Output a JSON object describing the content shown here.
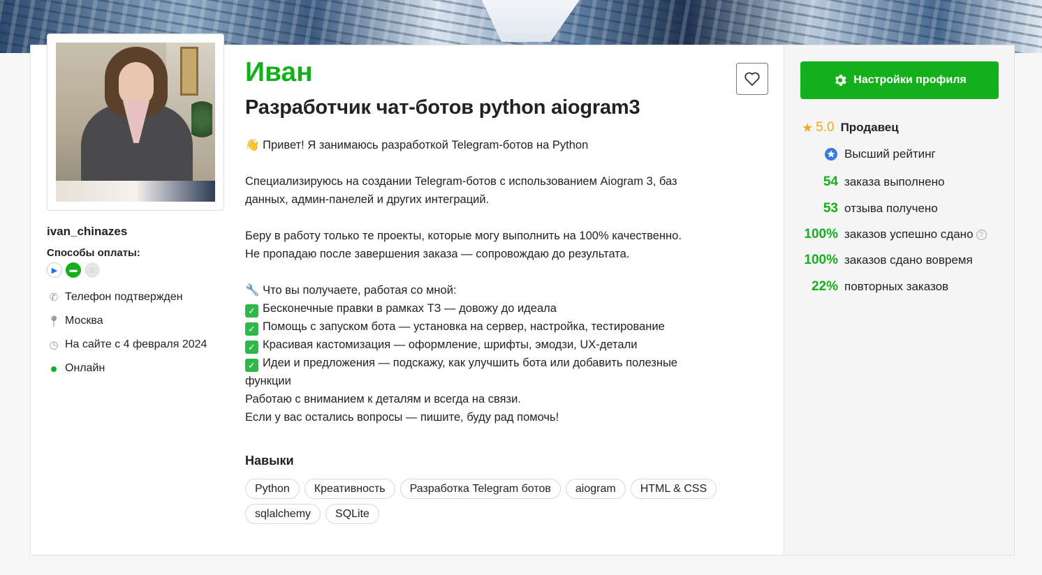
{
  "profile": {
    "name": "Иван",
    "title": "Разработчик чат-ботов python aiogram3",
    "username": "ivan_chinazes",
    "payment_label": "Способы оплаты:",
    "info": {
      "phone": "Телефон подтвержден",
      "city": "Москва",
      "since": "На сайте с 4 февраля 2024",
      "status": "Онлайн"
    }
  },
  "description": {
    "greeting": "👋 Привет! Я занимаюсь разработкой Telegram-ботов на Python",
    "line1": "Специализируюсь на создании Telegram-ботов с использованием Aiogram 3, баз",
    "line2": "данных, админ-панелей и других интеграций.",
    "line3": "Беру в работу только те проекты, которые могу выполнить на 100% качественно.",
    "line4": "Не пропадаю после завершения заказа — сопровождаю до результата.",
    "benefits_title": "🔧 Что вы получаете, работая со мной:",
    "benefits": [
      "Бесконечные правки в рамках ТЗ — довожу до идеала",
      "Помощь с запуском бота — установка на сервер, настройка, тестирование",
      "Красивая кастомизация — оформление, шрифты, эмодзи, UX-детали",
      "Идеи и предложения — подскажу, как улучшить бота или добавить полезные"
    ],
    "benefit_cont": "функции",
    "closing1": "Работаю с вниманием к деталям и всегда на связи.",
    "closing2": "Если у вас остались вопросы — пишите, буду рад помочь!"
  },
  "skills": {
    "title": "Навыки",
    "items": [
      "Python",
      "Креативность",
      "Разработка Telegram ботов",
      "aiogram",
      "HTML & CSS",
      "sqlalchemy",
      "SQLite"
    ]
  },
  "sidebar": {
    "settings_label": "Настройки профиля",
    "rating": "5.0",
    "role": "Продавец",
    "top_rating": "Высший рейтинг",
    "stats": [
      {
        "num": "54",
        "label": "заказа выполнено"
      },
      {
        "num": "53",
        "label": "отзыва получено"
      },
      {
        "num": "100%",
        "label": "заказов успешно сдано"
      },
      {
        "num": "100%",
        "label": "заказов сдано вовремя"
      },
      {
        "num": "22%",
        "label": "повторных заказов"
      }
    ]
  },
  "colors": {
    "accent": "#13b01b",
    "star": "#f5a623"
  }
}
